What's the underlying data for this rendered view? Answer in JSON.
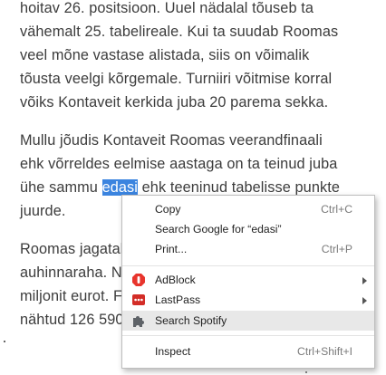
{
  "article": {
    "lines": [
      "hoitav 26. positsioon. Uuel nädalal tõuseb ta",
      "vähemalt 25. tabelireale. Kui ta suudab Roomas",
      "veel mõne vastase alistada, siis on võimalik",
      "tõusta veelgi kõrgemale. Turniiri võitmise korral",
      "võiks Kontaveit kerkida juba 20 parema sekka.",
      "Mullu jõudis Kontaveit Roomas veerandfinaali",
      "ehk võrreldes eelmise aastaga on ta teinud juba",
      "juurde.",
      "Roomas jagatal",
      "auhinnaraha. Na",
      "miljonit eurot. F",
      "nähtud 126 590"
    ],
    "selected_line": {
      "before": "ühe sammu ",
      "selected": "edasi",
      "after": " ehk teeninud tabelisse punkte"
    }
  },
  "context_menu": {
    "items": [
      {
        "label": "Copy",
        "shortcut": "Ctrl+C"
      },
      {
        "label": "Search Google for “edasi”",
        "shortcut": ""
      },
      {
        "label": "Print...",
        "shortcut": "Ctrl+P"
      },
      {
        "label": "AdBlock",
        "icon": "adblock-icon",
        "submenu": true
      },
      {
        "label": "LastPass",
        "icon": "lastpass-icon",
        "submenu": true
      },
      {
        "label": "Search Spotify",
        "icon": "puzzle-extension-icon"
      },
      {
        "label": "Inspect",
        "shortcut": "Ctrl+Shift+I"
      }
    ]
  },
  "colors": {
    "selection": "#3b84df",
    "adblock": "#e8352d",
    "lastpass": "#d32d27",
    "hover": "#e8e8e8"
  }
}
